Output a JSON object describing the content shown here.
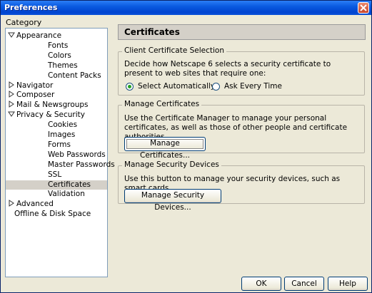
{
  "window": {
    "title": "Preferences"
  },
  "sidebar": {
    "label": "Category",
    "items": [
      {
        "label": "Appearance",
        "level": 0,
        "twisty": "down"
      },
      {
        "label": "Fonts",
        "level": 1
      },
      {
        "label": "Colors",
        "level": 1
      },
      {
        "label": "Themes",
        "level": 1
      },
      {
        "label": "Content Packs",
        "level": 1
      },
      {
        "label": "Navigator",
        "level": 0,
        "twisty": "right"
      },
      {
        "label": "Composer",
        "level": 0,
        "twisty": "right"
      },
      {
        "label": "Mail & Newsgroups",
        "level": 0,
        "twisty": "right"
      },
      {
        "label": "Privacy & Security",
        "level": 0,
        "twisty": "down"
      },
      {
        "label": "Cookies",
        "level": 1
      },
      {
        "label": "Images",
        "level": 1
      },
      {
        "label": "Forms",
        "level": 1
      },
      {
        "label": "Web Passwords",
        "level": 1
      },
      {
        "label": "Master Passwords",
        "level": 1
      },
      {
        "label": "SSL",
        "level": 1
      },
      {
        "label": "Certificates",
        "level": 1,
        "selected": true
      },
      {
        "label": "Validation",
        "level": 1
      },
      {
        "label": "Advanced",
        "level": 0,
        "twisty": "right"
      },
      {
        "label": "Offline & Disk Space",
        "level": 1
      }
    ]
  },
  "main": {
    "header": "Certificates",
    "client_selection": {
      "legend": "Client Certificate Selection",
      "description": "Decide how Netscape 6 selects a security certificate to present to web sites that require one:",
      "options": [
        {
          "label": "Select Automatically",
          "selected": true
        },
        {
          "label": "Ask Every Time",
          "selected": false
        }
      ]
    },
    "manage_certificates": {
      "legend": "Manage Certificates",
      "description": "Use the Certificate Manager to manage your personal certificates, as well as those of other people and certificate authorities.",
      "button": "Manage Certificates..."
    },
    "manage_devices": {
      "legend": "Manage Security Devices",
      "description": "Use this button to manage your security devices, such as smart cards.",
      "button": "Manage Security Devices..."
    }
  },
  "footer": {
    "ok": "OK",
    "cancel": "Cancel",
    "help": "Help"
  },
  "colors": {
    "titlebar": "#0a5ae0",
    "window_bg": "#ece9d8",
    "selected_row": "#d4d0c8"
  }
}
